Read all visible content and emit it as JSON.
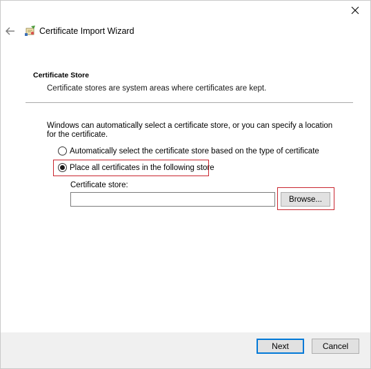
{
  "window": {
    "title": "Certificate Import Wizard",
    "icons": {
      "close": "close-icon",
      "back": "back-arrow-icon",
      "wizard": "certificate-wizard-icon"
    }
  },
  "section": {
    "title": "Certificate Store",
    "description": "Certificate stores are system areas where certificates are kept."
  },
  "body": {
    "info": "Windows can automatically select a certificate store, or you can specify a location for the certificate.",
    "options": [
      {
        "label": "Automatically select the certificate store based on the type of certificate",
        "selected": false
      },
      {
        "label": "Place all certificates in the following store",
        "selected": true
      }
    ],
    "store": {
      "label": "Certificate store:",
      "value": "",
      "browse_label": "Browse..."
    }
  },
  "footer": {
    "next_label": "Next",
    "cancel_label": "Cancel"
  },
  "colors": {
    "highlight": "#c8232c",
    "accent": "#0078d7",
    "footer_bg": "#f0f0f0"
  }
}
